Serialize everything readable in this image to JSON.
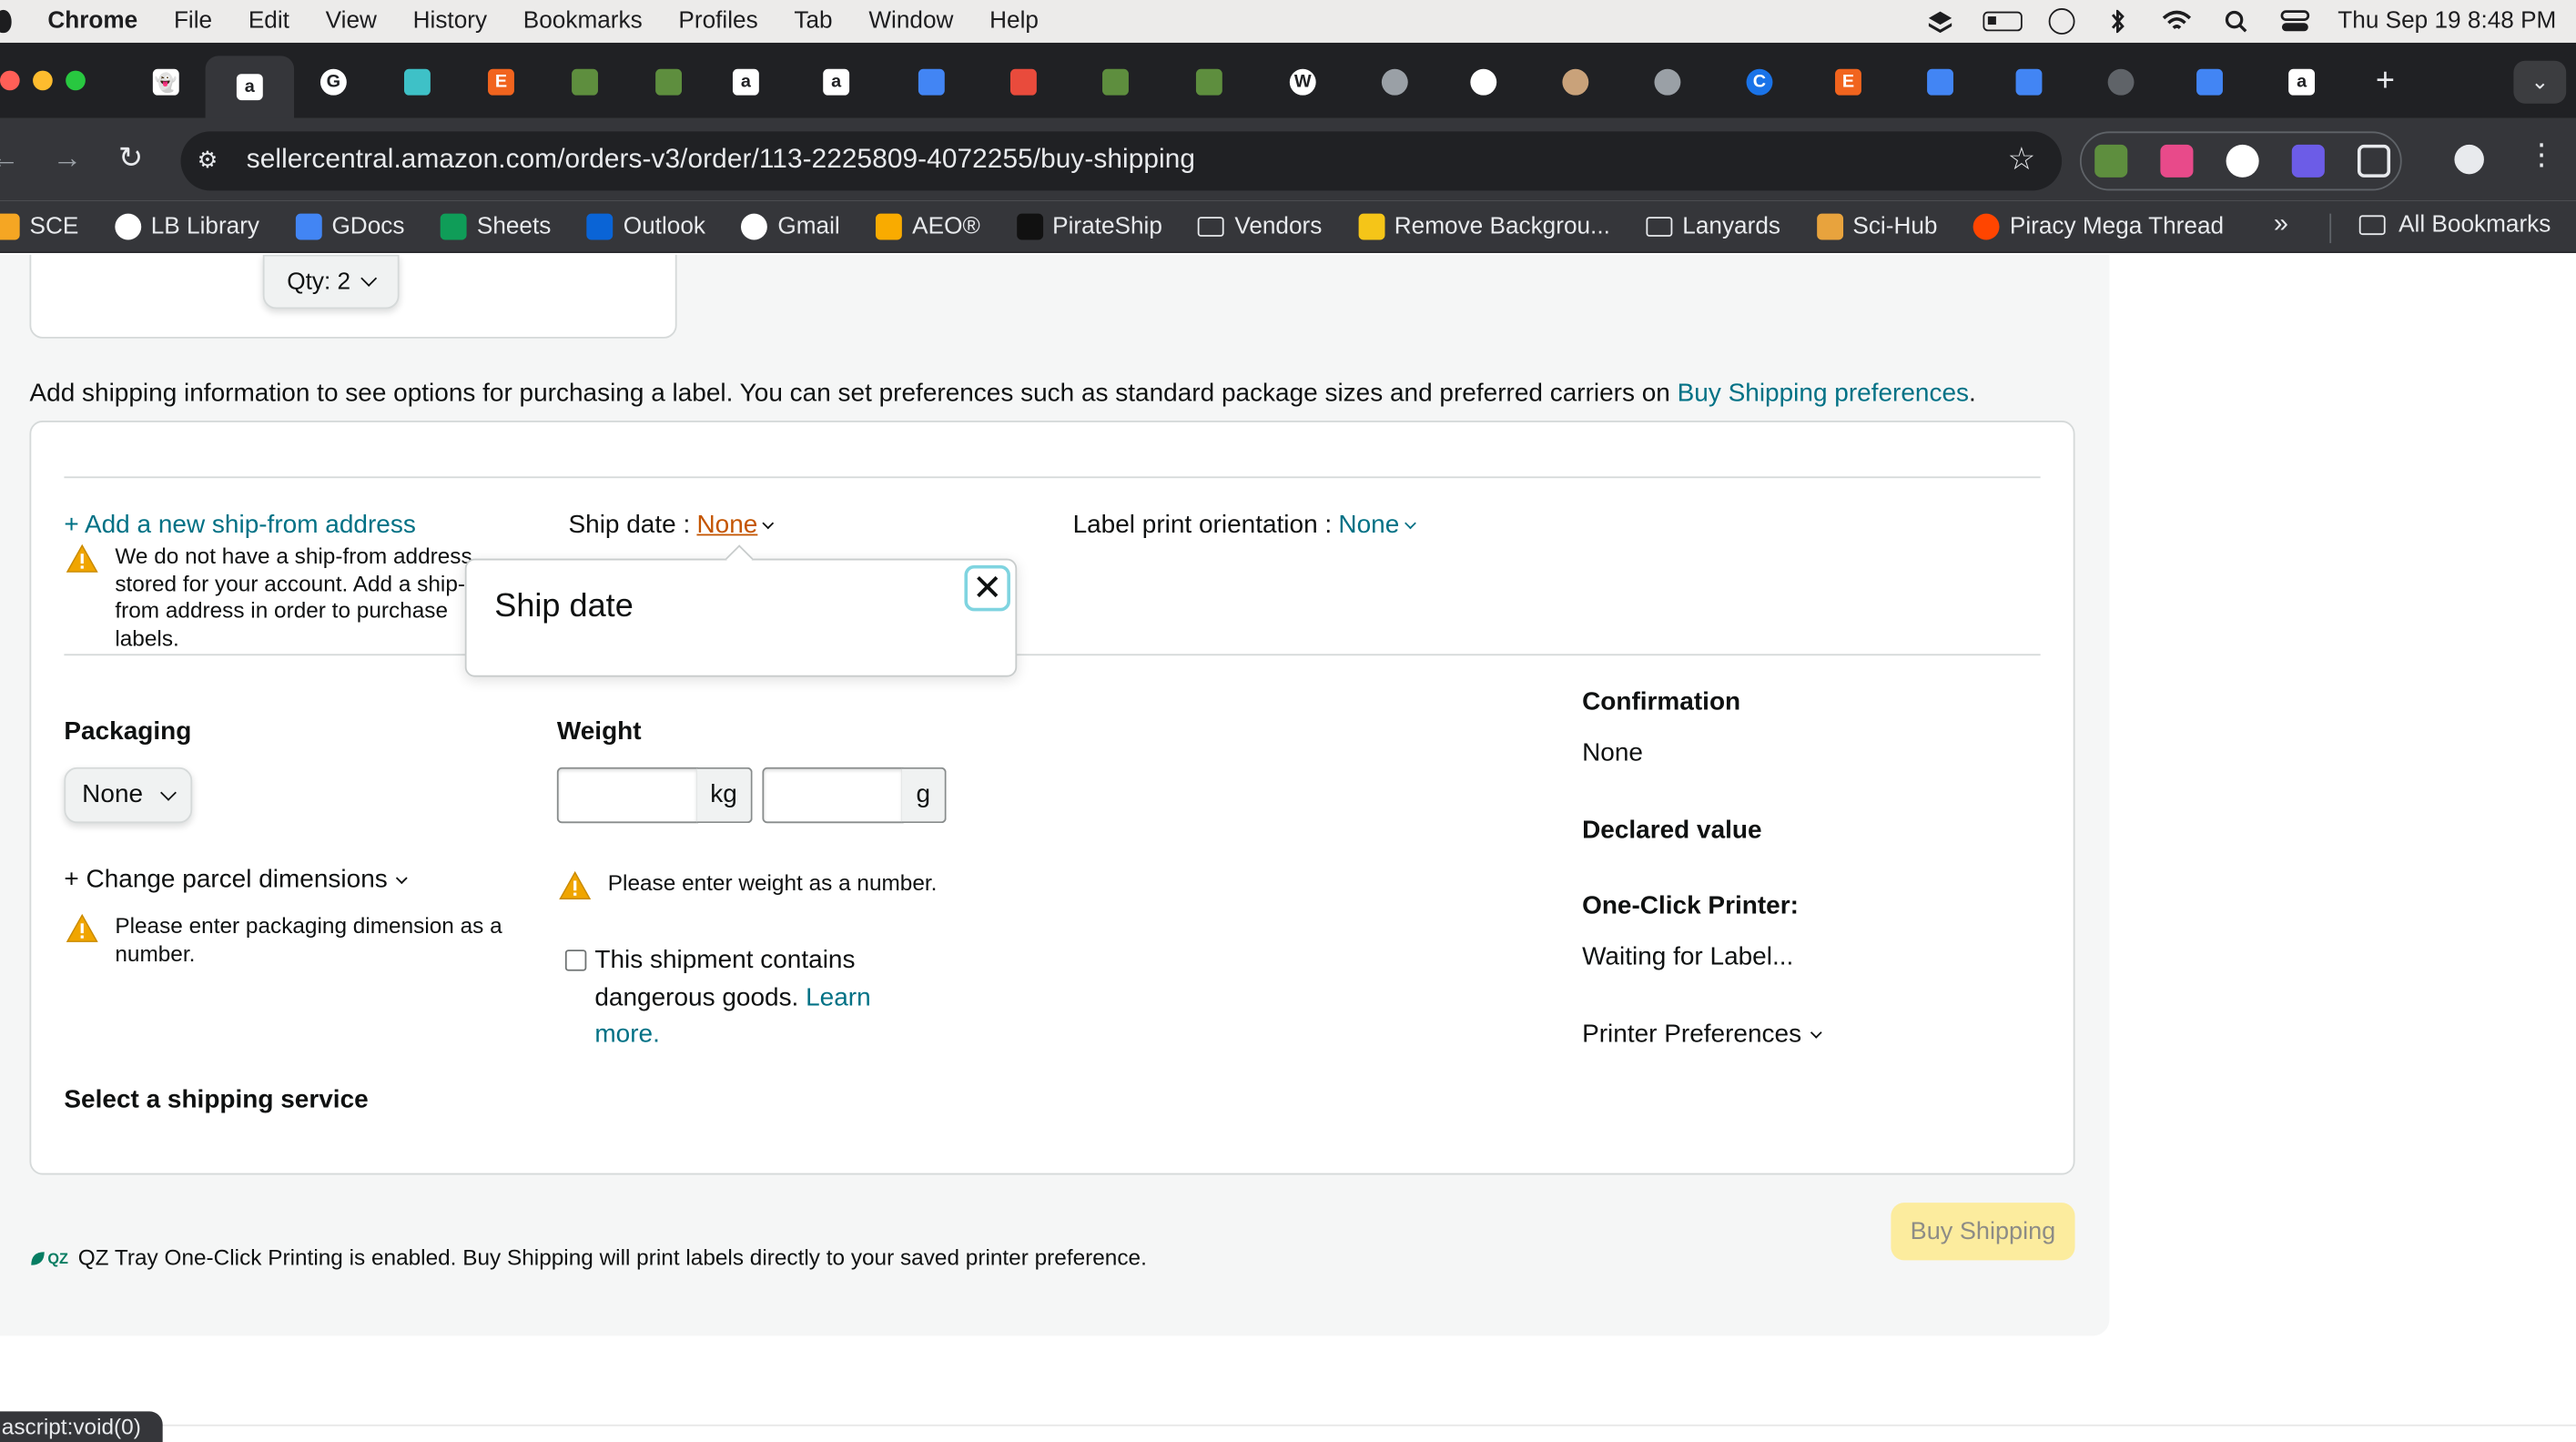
{
  "menubar": {
    "app": "Chrome",
    "items": [
      "File",
      "Edit",
      "View",
      "History",
      "Bookmarks",
      "Profiles",
      "Tab",
      "Window",
      "Help"
    ],
    "clock": "Thu Sep 19  8:48 PM"
  },
  "tabs": [
    {
      "icon": "ghost-icon",
      "color": "#ffffff",
      "glyph": "👻",
      "active": false
    },
    {
      "icon": "amazon-icon",
      "color": "#ffffff",
      "glyph": "a",
      "active": true
    },
    {
      "icon": "google-icon",
      "color": "#ffffff",
      "glyph": "G",
      "active": false
    },
    {
      "icon": "shield-icon",
      "color": "#3ec1c7",
      "glyph": "",
      "active": false
    },
    {
      "icon": "etsy-icon",
      "color": "#f1641e",
      "glyph": "E",
      "active": false
    },
    {
      "icon": "shopify-icon",
      "color": "#5e8e3e",
      "glyph": "",
      "active": false
    },
    {
      "icon": "shopify-icon",
      "color": "#5e8e3e",
      "glyph": "",
      "active": false
    },
    {
      "icon": "amazon-icon",
      "color": "#ffffff",
      "glyph": "a",
      "active": false
    },
    {
      "icon": "amazon-icon",
      "color": "#ffffff",
      "glyph": "a",
      "active": false
    },
    {
      "icon": "google-ads-icon",
      "color": "#4285f4",
      "glyph": "",
      "active": false
    },
    {
      "icon": "tomato-icon",
      "color": "#e94b3c",
      "glyph": "",
      "active": false
    },
    {
      "icon": "shopify-icon",
      "color": "#5e8e3e",
      "glyph": "",
      "active": false
    },
    {
      "icon": "shopify-icon",
      "color": "#5e8e3e",
      "glyph": "",
      "active": false
    },
    {
      "icon": "wordpress-icon",
      "color": "#ffffff",
      "glyph": "W",
      "active": false
    },
    {
      "icon": "globe-icon",
      "color": "#9aa0a6",
      "glyph": "",
      "active": false
    },
    {
      "icon": "chatgpt-icon",
      "color": "#ffffff",
      "glyph": "",
      "active": false
    },
    {
      "icon": "cookie-icon",
      "color": "#c9a27a",
      "glyph": "",
      "active": false
    },
    {
      "icon": "globe-icon",
      "color": "#9aa0a6",
      "glyph": "",
      "active": false
    },
    {
      "icon": "canva-icon",
      "color": "#1a73e8",
      "glyph": "C",
      "active": false
    },
    {
      "icon": "etsy-icon",
      "color": "#f1641e",
      "glyph": "E",
      "active": false
    },
    {
      "icon": "google-ads-icon",
      "color": "#4285f4",
      "glyph": "",
      "active": false
    },
    {
      "icon": "docs-icon",
      "color": "#4285f4",
      "glyph": "",
      "active": false
    },
    {
      "icon": "dots-icon",
      "color": "#5f6368",
      "glyph": "",
      "active": false
    },
    {
      "icon": "google-ads-icon",
      "color": "#4285f4",
      "glyph": "",
      "active": false
    },
    {
      "icon": "amazon-icon",
      "color": "#ffffff",
      "glyph": "a",
      "active": false
    }
  ],
  "toolbar": {
    "url": "sellercentral.amazon.com/orders-v3/order/113-2225809-4072255/buy-shipping"
  },
  "bookmarks": [
    {
      "label": "SCE",
      "icon": "sce-icon",
      "color": "#f5a623"
    },
    {
      "label": "LB Library",
      "icon": "lb-icon",
      "color": "#ffffff"
    },
    {
      "label": "GDocs",
      "icon": "docs-icon",
      "color": "#4285f4"
    },
    {
      "label": "Sheets",
      "icon": "sheets-icon",
      "color": "#0f9d58"
    },
    {
      "label": "Outlook",
      "icon": "outlook-icon",
      "color": "#0a64d6"
    },
    {
      "label": "Gmail",
      "icon": "google-icon",
      "color": "#ffffff"
    },
    {
      "label": "AEO®",
      "icon": "analytics-icon",
      "color": "#f9ab00"
    },
    {
      "label": "PirateShip",
      "icon": "pirate-icon",
      "color": "#111111"
    },
    {
      "label": "Vendors",
      "icon": "folder-icon",
      "color": ""
    },
    {
      "label": "Remove Backgrou...",
      "icon": "removebg-icon",
      "color": "#f5c518"
    },
    {
      "label": "Lanyards",
      "icon": "folder-icon",
      "color": ""
    },
    {
      "label": "Sci-Hub",
      "icon": "scihub-icon",
      "color": "#e8a33d"
    },
    {
      "label": "Piracy Mega Thread",
      "icon": "reddit-icon",
      "color": "#ff4500"
    }
  ],
  "bookmarks_more": "»",
  "bookmarks_all": "All Bookmarks",
  "page": {
    "qty_label": "Qty: 2",
    "info_text": "Add shipping information to see options for purchasing a label. You can set preferences such as standard package sizes and preferred carriers on ",
    "info_link": "Buy Shipping preferences",
    "info_end": ".",
    "add_address": "+ Add a new ship-from address",
    "address_warning": "We do not have a ship-from address stored for your account. Add a ship-from address in order to purchase labels.",
    "ship_date_label": "Ship date : ",
    "ship_date_value": "None",
    "orientation_label": "Label print orientation : ",
    "orientation_value": "None",
    "popover_title": "Ship date",
    "packaging_label": "Packaging",
    "packaging_value": "None",
    "weight_label": "Weight",
    "kg_unit": "kg",
    "g_unit": "g",
    "change_dims": "+ Change parcel dimensions",
    "dims_warning": "Please enter packaging dimension as a number.",
    "weight_warning": "Please enter weight as a number.",
    "dangerous_text": "This shipment contains dangerous goods. ",
    "learn_more": "Learn more.",
    "select_service": "Select a shipping service",
    "confirmation_label": "Confirmation",
    "confirmation_value": "None",
    "declared_label": "Declared value",
    "printer_label": "One-Click Printer:",
    "printer_status": "Waiting for Label...",
    "printer_prefs": "Printer Preferences",
    "qz_logo": "QZ",
    "qz_note": "QZ Tray One-Click Printing is enabled. Buy Shipping will print labels directly to your saved printer preference.",
    "buy_button": "Buy Shipping",
    "status_url": "ascript:void(0)"
  }
}
